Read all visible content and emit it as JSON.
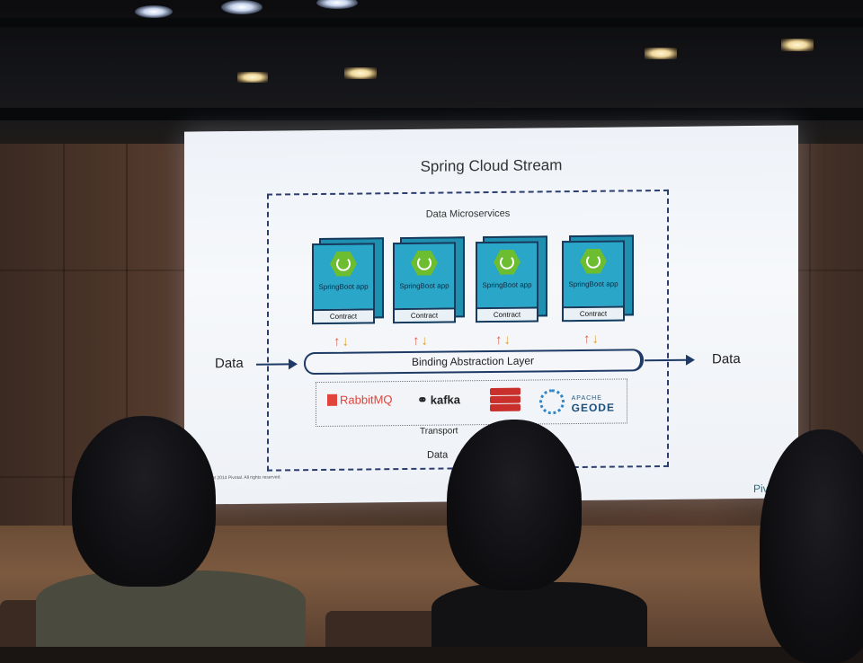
{
  "slide": {
    "title": "Spring Cloud Stream",
    "group_label": "Data Microservices",
    "apps": [
      {
        "name": "SpringBoot app",
        "contract": "Contract"
      },
      {
        "name": "SpringBoot app",
        "contract": "Contract"
      },
      {
        "name": "SpringBoot app",
        "contract": "Contract"
      },
      {
        "name": "SpringBoot app",
        "contract": "Contract"
      }
    ],
    "binding_layer": "Binding Abstraction Layer",
    "data_in": "Data",
    "data_out": "Data",
    "transports": {
      "rabbitmq": "RabbitMQ",
      "kafka": "kafka",
      "geode_small": "APACHE",
      "geode_big": "GEODE"
    },
    "transport_label": "Transport",
    "bottom_label": "Data",
    "copyright": "ght 2014 Pivotal. All rights reserved.",
    "brand": "Pivotal"
  },
  "colors": {
    "spring_green": "#6cbd2f",
    "app_teal": "#2aa6c8",
    "navy": "#1e3a66",
    "rabbit_red": "#e0443a"
  }
}
